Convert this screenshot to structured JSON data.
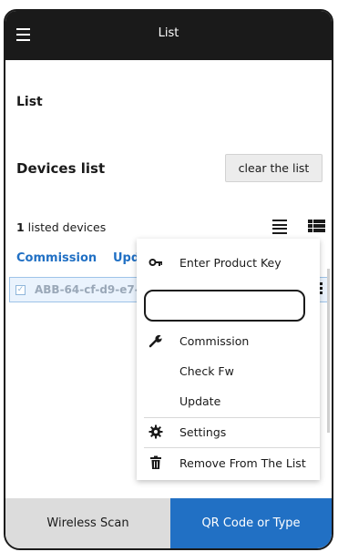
{
  "header": {
    "title": "List",
    "menu_icon": "hamburger-menu-icon"
  },
  "main": {
    "section_title": "List",
    "devices_title": "Devices list",
    "clear_label": "clear the list",
    "listed_count": "1",
    "listed_suffix": " listed devices",
    "tabs": [
      {
        "label": "Commission"
      },
      {
        "label": "Update"
      }
    ]
  },
  "device": {
    "name": "ABB-64-cf-d9-e7-96-98",
    "checked": true
  },
  "context_menu": {
    "items": [
      {
        "label": "Enter Product Key",
        "icon": "key-icon"
      },
      {
        "label": "Commission",
        "icon": "wrench-icon"
      },
      {
        "label": "Check Fw",
        "icon": ""
      },
      {
        "label": "Update",
        "icon": ""
      },
      {
        "label": "Settings",
        "icon": "gear-icon"
      },
      {
        "label": "Remove From The List",
        "icon": "trash-icon"
      }
    ]
  },
  "bottom": {
    "scan_label": "Wireless Scan",
    "qr_label": "QR Code or Type"
  },
  "colors": {
    "accent": "#2170c4",
    "topbar": "#1a1a1a",
    "selected_row": "#eaf3fd"
  }
}
